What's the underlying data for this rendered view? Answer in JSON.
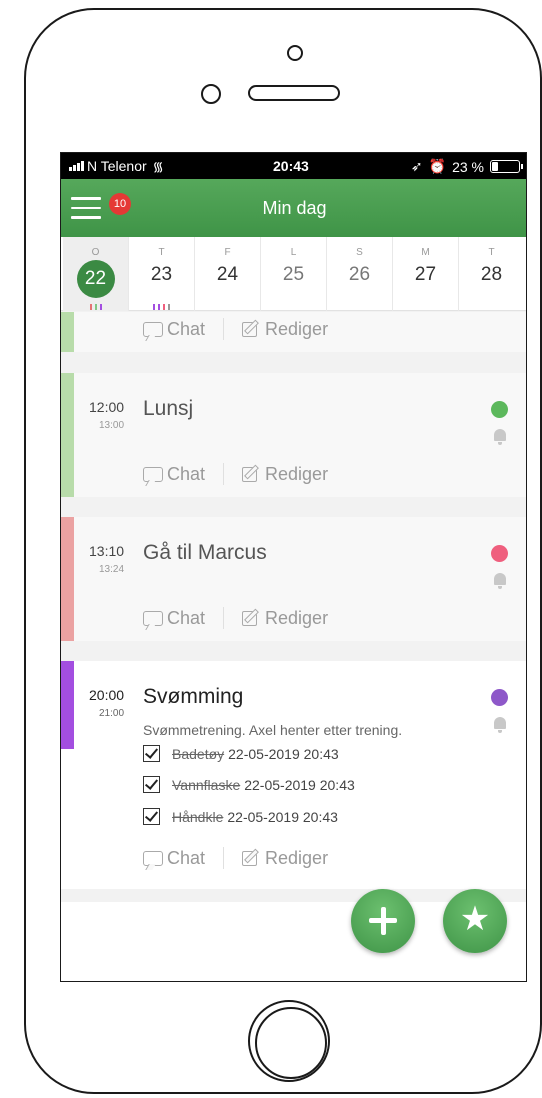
{
  "status": {
    "carrier": "N Telenor",
    "time": "20:43",
    "battery": "23 %",
    "battery_level": 0.23
  },
  "header": {
    "title": "Min dag",
    "badge": "10"
  },
  "days": [
    {
      "label": "O",
      "num": "22",
      "selected": true
    },
    {
      "label": "T",
      "num": "23",
      "selected": false
    },
    {
      "label": "F",
      "num": "24",
      "selected": false
    },
    {
      "label": "L",
      "num": "25",
      "selected": false
    },
    {
      "label": "S",
      "num": "26",
      "selected": false
    },
    {
      "label": "M",
      "num": "27",
      "selected": false
    },
    {
      "label": "T",
      "num": "28",
      "selected": false
    }
  ],
  "actions": {
    "chat": "Chat",
    "edit": "Rediger"
  },
  "events": [
    {
      "start": "12:00",
      "end": "13:00",
      "title": "Lunsj",
      "color": "#5cb85c",
      "bar_color": "#b8dcaa"
    },
    {
      "start": "13:10",
      "end": "13:24",
      "title": "Gå til Marcus",
      "color": "#ef5f7e",
      "bar_color": "#eba2a2"
    },
    {
      "start": "20:00",
      "end": "21:00",
      "title": "Svømming",
      "color": "#8e58c9",
      "bar_color": "#a34ee0",
      "description": "Svømmetrening. Axel henter etter trening.",
      "todos": [
        {
          "item": "Badetøy",
          "date": "22-05-2019 20:43"
        },
        {
          "item": "Vannflaske",
          "date": "22-05-2019 20:43"
        },
        {
          "item": "Håndkle",
          "date": "22-05-2019 20:43"
        }
      ]
    }
  ]
}
